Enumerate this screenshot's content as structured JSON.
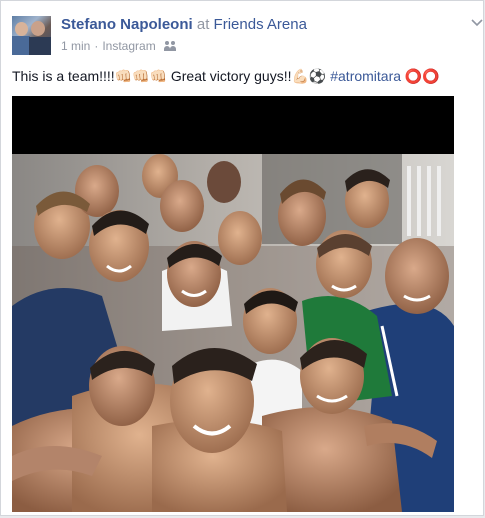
{
  "post": {
    "author": "Stefano Napoleoni",
    "at_label": "at",
    "place": "Friends Arena",
    "time": "1 min",
    "separator": "·",
    "source": "Instagram",
    "audience_icon": "people-icon",
    "menu_icon": "chevron-down-icon",
    "text_main": "This is a team!!!!👊🏻👊🏻👊🏻 Great victory guys!!💪🏻⚽ ",
    "hashtag": "#atromitara",
    "text_end": " ⭕⭕"
  },
  "colors": {
    "link": "#3b5998",
    "meta": "#9197a3",
    "text": "#141823",
    "border": "#d3d6db",
    "background": "#e9eaed"
  }
}
